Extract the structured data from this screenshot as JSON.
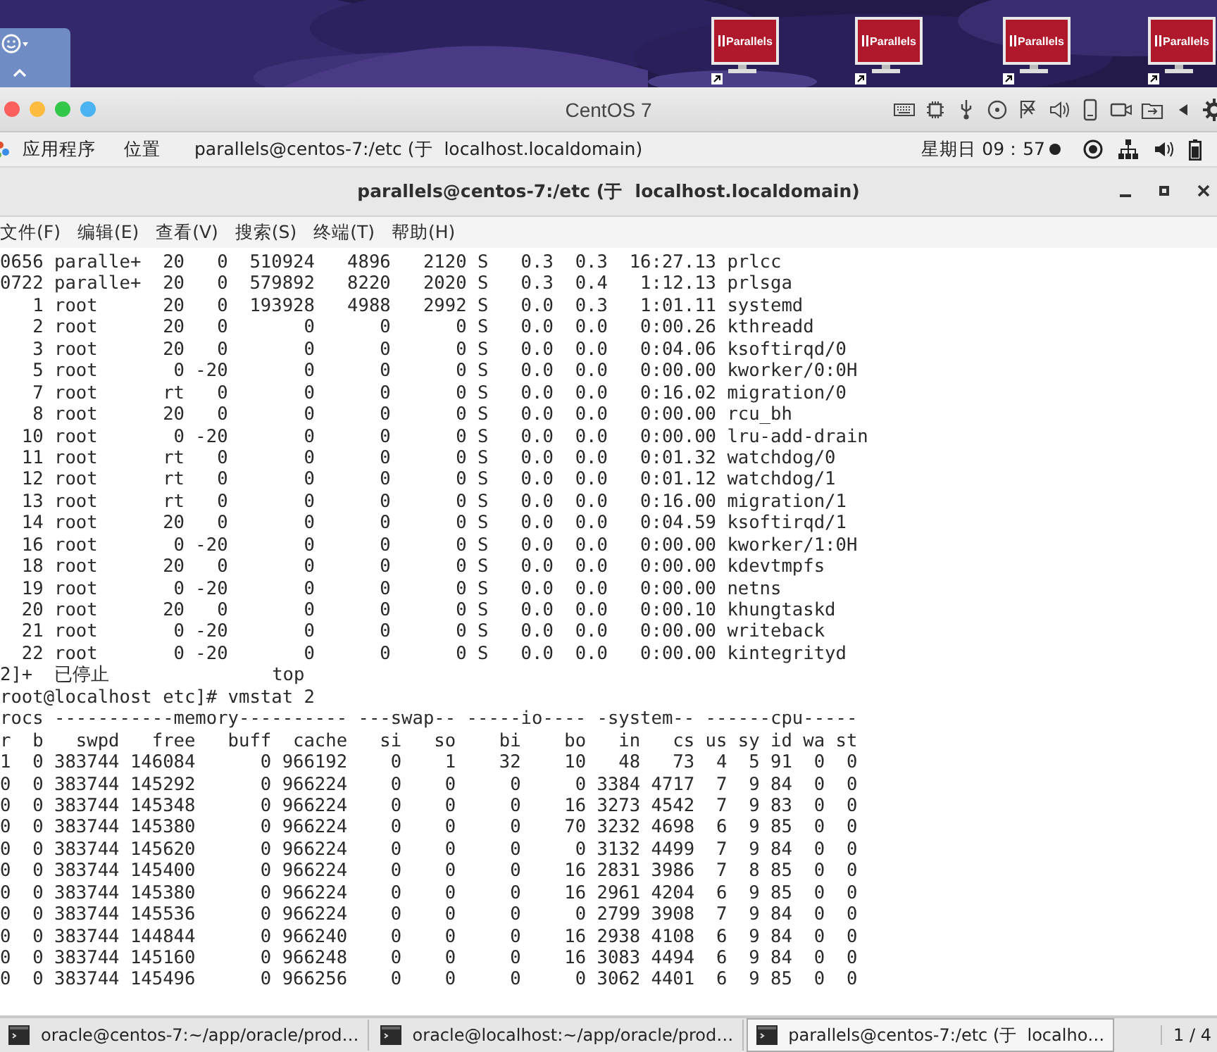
{
  "desktop": {
    "icons": [
      {
        "label": "Parallels"
      },
      {
        "label": "Parallels"
      },
      {
        "label": "Parallels"
      },
      {
        "label": "Parallels"
      }
    ]
  },
  "vm_window": {
    "title": "CentOS 7"
  },
  "top_bar": {
    "menus": [
      "应用程序",
      "位置"
    ],
    "window_title": "parallels@centos-7:/etc (于  localhost.localdomain)",
    "clock": "星期日 09：57"
  },
  "terminal": {
    "title": "parallels@centos-7:/etc (于  localhost.localdomain)",
    "menu": [
      "文件(F)",
      "编辑(E)",
      "查看(V)",
      "搜索(S)",
      "终端(T)",
      "帮助(H)"
    ],
    "lines": [
      "0656 paralle+  20   0  510924   4896   2120 S   0.3  0.3  16:27.13 prlcc",
      "0722 paralle+  20   0  579892   8220   2020 S   0.3  0.4   1:12.13 prlsga",
      "   1 root      20   0  193928   4988   2992 S   0.0  0.3   1:01.11 systemd",
      "   2 root      20   0       0      0      0 S   0.0  0.0   0:00.26 kthreadd",
      "   3 root      20   0       0      0      0 S   0.0  0.0   0:04.06 ksoftirqd/0",
      "   5 root       0 -20       0      0      0 S   0.0  0.0   0:00.00 kworker/0:0H",
      "   7 root      rt   0       0      0      0 S   0.0  0.0   0:16.02 migration/0",
      "   8 root      20   0       0      0      0 S   0.0  0.0   0:00.00 rcu_bh",
      "  10 root       0 -20       0      0      0 S   0.0  0.0   0:00.00 lru-add-drain",
      "  11 root      rt   0       0      0      0 S   0.0  0.0   0:01.32 watchdog/0",
      "  12 root      rt   0       0      0      0 S   0.0  0.0   0:01.12 watchdog/1",
      "  13 root      rt   0       0      0      0 S   0.0  0.0   0:16.00 migration/1",
      "  14 root      20   0       0      0      0 S   0.0  0.0   0:04.59 ksoftirqd/1",
      "  16 root       0 -20       0      0      0 S   0.0  0.0   0:00.00 kworker/1:0H",
      "  18 root      20   0       0      0      0 S   0.0  0.0   0:00.00 kdevtmpfs",
      "  19 root       0 -20       0      0      0 S   0.0  0.0   0:00.00 netns",
      "  20 root      20   0       0      0      0 S   0.0  0.0   0:00.10 khungtaskd",
      "  21 root       0 -20       0      0      0 S   0.0  0.0   0:00.00 writeback",
      "  22 root       0 -20       0      0      0 S   0.0  0.0   0:00.00 kintegrityd",
      "2]+  已停止               top",
      "root@localhost etc]# vmstat 2",
      "rocs -----------memory---------- ---swap-- -----io---- -system-- ------cpu-----",
      "r  b   swpd   free   buff  cache   si   so    bi    bo   in   cs us sy id wa st",
      "1  0 383744 146084      0 966192    0    1    32    10   48   73  4  5 91  0  0",
      "0  0 383744 145292      0 966224    0    0     0     0 3384 4717  7  9 84  0  0",
      "0  0 383744 145348      0 966224    0    0     0    16 3273 4542  7  9 83  0  0",
      "0  0 383744 145380      0 966224    0    0     0    70 3232 4698  6  9 85  0  0",
      "0  0 383744 145620      0 966224    0    0     0     0 3132 4499  7  9 84  0  0",
      "0  0 383744 145400      0 966224    0    0     0    16 2831 3986  7  8 85  0  0",
      "0  0 383744 145380      0 966224    0    0     0    16 2961 4204  6  9 85  0  0",
      "0  0 383744 145536      0 966224    0    0     0     0 2799 3908  7  9 84  0  0",
      "0  0 383744 144844      0 966240    0    0     0    16 2938 4108  6  9 84  0  0",
      "0  0 383744 145160      0 966248    0    0     0    16 3083 4494  6  9 84  0  0",
      "0  0 383744 145496      0 966256    0    0     0     0 3062 4401  6  9 85  0  0"
    ]
  },
  "taskbar": {
    "items": [
      {
        "label": "oracle@centos-7:~/app/oracle/prod…",
        "selected": false
      },
      {
        "label": "oracle@localhost:~/app/oracle/prod…",
        "selected": false
      },
      {
        "label": "parallels@centos-7:/etc (于  localho…",
        "selected": true
      }
    ],
    "pager": "1 / 4"
  }
}
